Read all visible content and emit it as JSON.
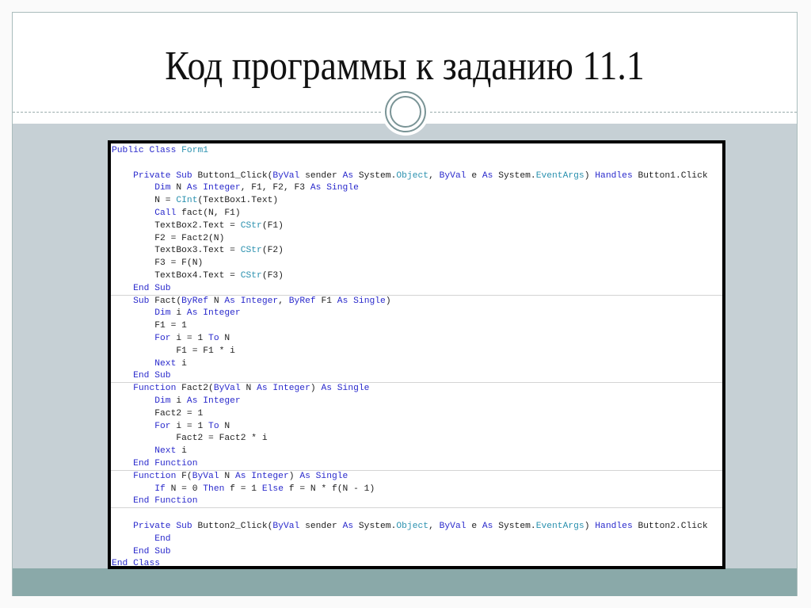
{
  "slide": {
    "title": "Код программы к заданию 11.1",
    "decoration": "double-ring-circle-icon"
  },
  "colors": {
    "keyword": "#2a2acc",
    "type": "#2b91af",
    "text": "#1e1e1e",
    "gray_band": "#c6d0d5",
    "teal_band": "#8aa9a9"
  },
  "code": {
    "language": "Visual Basic",
    "lines": [
      {
        "sep": false,
        "tokens": [
          [
            "kw",
            "Public Class "
          ],
          [
            "ty",
            "Form1"
          ]
        ]
      },
      {
        "sep": false,
        "tokens": []
      },
      {
        "sep": false,
        "tokens": [
          [
            "tx",
            "    "
          ],
          [
            "kw",
            "Private Sub "
          ],
          [
            "tx",
            "Button1_Click("
          ],
          [
            "kw",
            "ByVal "
          ],
          [
            "tx",
            "sender "
          ],
          [
            "kw",
            "As "
          ],
          [
            "tx",
            "System."
          ],
          [
            "ty",
            "Object"
          ],
          [
            "tx",
            ", "
          ],
          [
            "kw",
            "ByVal "
          ],
          [
            "tx",
            "e "
          ],
          [
            "kw",
            "As "
          ],
          [
            "tx",
            "System."
          ],
          [
            "ty",
            "EventArgs"
          ],
          [
            "tx",
            ") "
          ],
          [
            "kw",
            "Handles "
          ],
          [
            "tx",
            "Button1.Click"
          ]
        ]
      },
      {
        "sep": false,
        "tokens": [
          [
            "tx",
            "        "
          ],
          [
            "kw",
            "Dim "
          ],
          [
            "tx",
            "N "
          ],
          [
            "kw",
            "As Integer"
          ],
          [
            "tx",
            ", F1, F2, F3 "
          ],
          [
            "kw",
            "As Single"
          ]
        ]
      },
      {
        "sep": false,
        "tokens": [
          [
            "tx",
            "        N = "
          ],
          [
            "ty",
            "CInt"
          ],
          [
            "tx",
            "(TextBox1.Text)"
          ]
        ]
      },
      {
        "sep": false,
        "tokens": [
          [
            "tx",
            "        "
          ],
          [
            "kw",
            "Call "
          ],
          [
            "tx",
            "fact(N, F1)"
          ]
        ]
      },
      {
        "sep": false,
        "tokens": [
          [
            "tx",
            "        TextBox2.Text = "
          ],
          [
            "ty",
            "CStr"
          ],
          [
            "tx",
            "(F1)"
          ]
        ]
      },
      {
        "sep": false,
        "tokens": [
          [
            "tx",
            "        F2 = Fact2(N)"
          ]
        ]
      },
      {
        "sep": false,
        "tokens": [
          [
            "tx",
            "        TextBox3.Text = "
          ],
          [
            "ty",
            "CStr"
          ],
          [
            "tx",
            "(F2)"
          ]
        ]
      },
      {
        "sep": false,
        "tokens": [
          [
            "tx",
            "        F3 = F(N)"
          ]
        ]
      },
      {
        "sep": false,
        "tokens": [
          [
            "tx",
            "        TextBox4.Text = "
          ],
          [
            "ty",
            "CStr"
          ],
          [
            "tx",
            "(F3)"
          ]
        ]
      },
      {
        "sep": false,
        "tokens": [
          [
            "tx",
            "    "
          ],
          [
            "kw",
            "End Sub"
          ]
        ]
      },
      {
        "sep": true,
        "tokens": [
          [
            "tx",
            "    "
          ],
          [
            "kw",
            "Sub "
          ],
          [
            "tx",
            "Fact("
          ],
          [
            "kw",
            "ByRef "
          ],
          [
            "tx",
            "N "
          ],
          [
            "kw",
            "As Integer"
          ],
          [
            "tx",
            ", "
          ],
          [
            "kw",
            "ByRef "
          ],
          [
            "tx",
            "F1 "
          ],
          [
            "kw",
            "As Single"
          ],
          [
            "tx",
            ")"
          ]
        ]
      },
      {
        "sep": false,
        "tokens": [
          [
            "tx",
            "        "
          ],
          [
            "kw",
            "Dim "
          ],
          [
            "tx",
            "i "
          ],
          [
            "kw",
            "As Integer"
          ]
        ]
      },
      {
        "sep": false,
        "tokens": [
          [
            "tx",
            "        F1 = 1"
          ]
        ]
      },
      {
        "sep": false,
        "tokens": [
          [
            "tx",
            "        "
          ],
          [
            "kw",
            "For "
          ],
          [
            "tx",
            "i = 1 "
          ],
          [
            "kw",
            "To "
          ],
          [
            "tx",
            "N"
          ]
        ]
      },
      {
        "sep": false,
        "tokens": [
          [
            "tx",
            "            F1 = F1 * i"
          ]
        ]
      },
      {
        "sep": false,
        "tokens": [
          [
            "tx",
            "        "
          ],
          [
            "kw",
            "Next "
          ],
          [
            "tx",
            "i"
          ]
        ]
      },
      {
        "sep": false,
        "tokens": [
          [
            "tx",
            "    "
          ],
          [
            "kw",
            "End Sub"
          ]
        ]
      },
      {
        "sep": true,
        "tokens": [
          [
            "tx",
            "    "
          ],
          [
            "kw",
            "Function "
          ],
          [
            "tx",
            "Fact2("
          ],
          [
            "kw",
            "ByVal "
          ],
          [
            "tx",
            "N "
          ],
          [
            "kw",
            "As Integer"
          ],
          [
            "tx",
            ") "
          ],
          [
            "kw",
            "As Single"
          ]
        ]
      },
      {
        "sep": false,
        "tokens": [
          [
            "tx",
            "        "
          ],
          [
            "kw",
            "Dim "
          ],
          [
            "tx",
            "i "
          ],
          [
            "kw",
            "As Integer"
          ]
        ]
      },
      {
        "sep": false,
        "tokens": [
          [
            "tx",
            "        Fact2 = 1"
          ]
        ]
      },
      {
        "sep": false,
        "tokens": [
          [
            "tx",
            "        "
          ],
          [
            "kw",
            "For "
          ],
          [
            "tx",
            "i = 1 "
          ],
          [
            "kw",
            "To "
          ],
          [
            "tx",
            "N"
          ]
        ]
      },
      {
        "sep": false,
        "tokens": [
          [
            "tx",
            "            Fact2 = Fact2 * i"
          ]
        ]
      },
      {
        "sep": false,
        "tokens": [
          [
            "tx",
            "        "
          ],
          [
            "kw",
            "Next "
          ],
          [
            "tx",
            "i"
          ]
        ]
      },
      {
        "sep": false,
        "tokens": [
          [
            "tx",
            "    "
          ],
          [
            "kw",
            "End Function"
          ]
        ]
      },
      {
        "sep": true,
        "tokens": [
          [
            "tx",
            "    "
          ],
          [
            "kw",
            "Function "
          ],
          [
            "tx",
            "F("
          ],
          [
            "kw",
            "ByVal "
          ],
          [
            "tx",
            "N "
          ],
          [
            "kw",
            "As Integer"
          ],
          [
            "tx",
            ") "
          ],
          [
            "kw",
            "As Single"
          ]
        ]
      },
      {
        "sep": false,
        "tokens": [
          [
            "tx",
            "        "
          ],
          [
            "kw",
            "If "
          ],
          [
            "tx",
            "N = 0 "
          ],
          [
            "kw",
            "Then "
          ],
          [
            "tx",
            "f = 1 "
          ],
          [
            "kw",
            "Else "
          ],
          [
            "tx",
            "f = N * f(N - 1)"
          ]
        ]
      },
      {
        "sep": false,
        "tokens": [
          [
            "tx",
            "    "
          ],
          [
            "kw",
            "End Function"
          ]
        ]
      },
      {
        "sep": true,
        "tokens": []
      },
      {
        "sep": false,
        "tokens": [
          [
            "tx",
            "    "
          ],
          [
            "kw",
            "Private Sub "
          ],
          [
            "tx",
            "Button2_Click("
          ],
          [
            "kw",
            "ByVal "
          ],
          [
            "tx",
            "sender "
          ],
          [
            "kw",
            "As "
          ],
          [
            "tx",
            "System."
          ],
          [
            "ty",
            "Object"
          ],
          [
            "tx",
            ", "
          ],
          [
            "kw",
            "ByVal "
          ],
          [
            "tx",
            "e "
          ],
          [
            "kw",
            "As "
          ],
          [
            "tx",
            "System."
          ],
          [
            "ty",
            "EventArgs"
          ],
          [
            "tx",
            ") "
          ],
          [
            "kw",
            "Handles "
          ],
          [
            "tx",
            "Button2.Click"
          ]
        ]
      },
      {
        "sep": false,
        "tokens": [
          [
            "tx",
            "        "
          ],
          [
            "kw",
            "End"
          ]
        ]
      },
      {
        "sep": false,
        "tokens": [
          [
            "tx",
            "    "
          ],
          [
            "kw",
            "End Sub"
          ]
        ]
      },
      {
        "sep": false,
        "tokens": [
          [
            "kw",
            "End Class"
          ]
        ]
      }
    ]
  }
}
